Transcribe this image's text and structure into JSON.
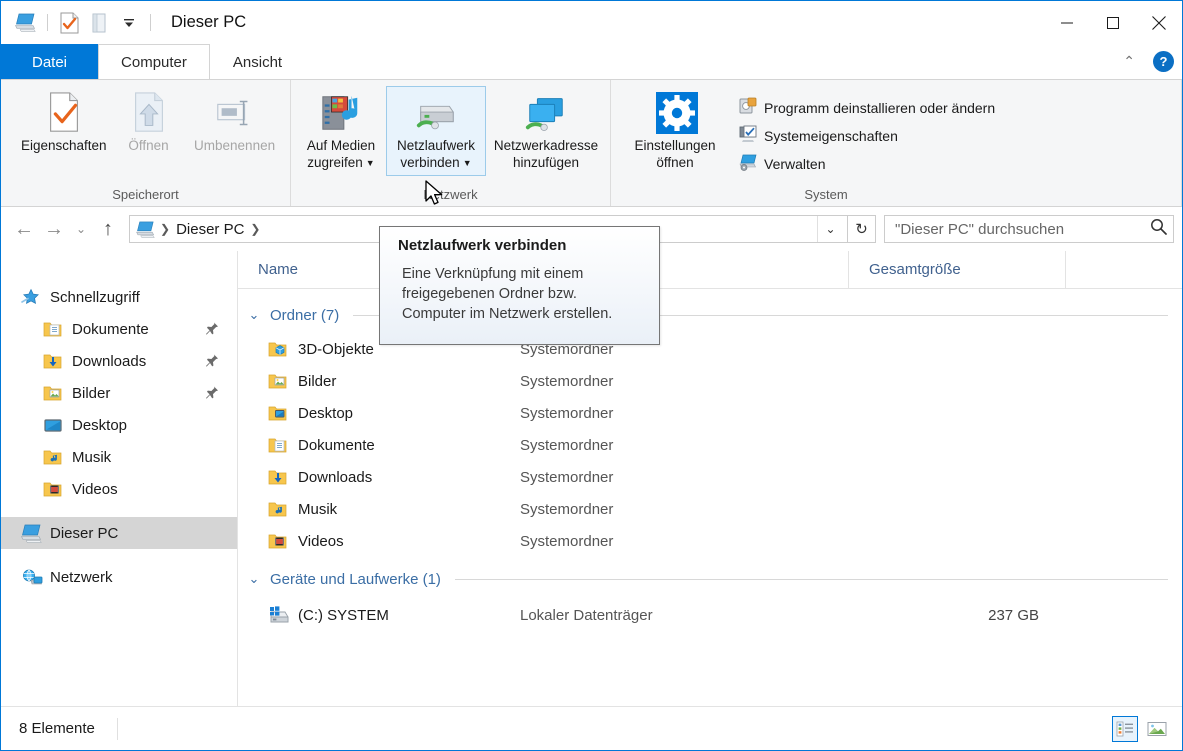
{
  "window": {
    "title": "Dieser PC",
    "quick_access": [
      "pc-icon",
      "properties-check-icon",
      "folder-icon",
      "dropdown-arrow-icon"
    ],
    "controls": {
      "minimize": "—",
      "maximize": "□",
      "close": "✕"
    }
  },
  "tabs": [
    {
      "id": "file",
      "label": "Datei"
    },
    {
      "id": "computer",
      "label": "Computer"
    },
    {
      "id": "view",
      "label": "Ansicht"
    }
  ],
  "ribbon": {
    "collapse_label": "⌃",
    "help_label": "?",
    "groups": [
      {
        "title": "Speicherort",
        "buttons": [
          {
            "label_line1": "Eigenschaften",
            "label_line2": "",
            "icon": "properties-icon",
            "disabled": false,
            "caret": false
          },
          {
            "label_line1": "Öffnen",
            "label_line2": "",
            "icon": "open-icon",
            "disabled": true,
            "caret": false
          },
          {
            "label_line1": "Umbenennen",
            "label_line2": "",
            "icon": "rename-icon",
            "disabled": true,
            "caret": false
          }
        ]
      },
      {
        "title": "Netzwerk",
        "buttons": [
          {
            "label_line1": "Auf Medien",
            "label_line2": "zugreifen",
            "icon": "media-server-icon",
            "disabled": false,
            "caret": true
          },
          {
            "label_line1": "Netzlaufwerk",
            "label_line2": "verbinden",
            "icon": "map-network-drive-icon",
            "disabled": false,
            "caret": true,
            "hover": true
          },
          {
            "label_line1": "Netzwerkadresse",
            "label_line2": "hinzufügen",
            "icon": "add-network-location-icon",
            "disabled": false,
            "caret": false
          }
        ]
      },
      {
        "title": "System",
        "big_button": {
          "label_line1": "Einstellungen",
          "label_line2": "öffnen",
          "icon": "settings-gear-icon"
        },
        "items": [
          {
            "label": "Programm deinstallieren oder ändern",
            "icon": "uninstall-program-icon"
          },
          {
            "label": "Systemeigenschaften",
            "icon": "system-properties-icon"
          },
          {
            "label": "Verwalten",
            "icon": "manage-computer-icon"
          }
        ]
      }
    ]
  },
  "addressbar": {
    "back": "←",
    "forward": "→",
    "recent": "⌄",
    "up": "↑",
    "crumb_icon": "pc-icon",
    "crumb": "Dieser PC",
    "crumb_sep": "❯",
    "dropdown": "⌄",
    "refresh": "↻",
    "search_placeholder": "\"Dieser PC\" durchsuchen",
    "search_value": "",
    "search_icon": "search-icon"
  },
  "sidebar": {
    "items": [
      {
        "label": "Schnellzugriff",
        "icon": "quick-access-star-icon",
        "indent": false,
        "pinned": false,
        "selected": false
      },
      {
        "label": "Dokumente",
        "icon": "documents-folder-icon",
        "indent": true,
        "pinned": true,
        "selected": false
      },
      {
        "label": "Downloads",
        "icon": "downloads-folder-icon",
        "indent": true,
        "pinned": true,
        "selected": false
      },
      {
        "label": "Bilder",
        "icon": "pictures-folder-icon",
        "indent": true,
        "pinned": true,
        "selected": false
      },
      {
        "label": "Desktop",
        "icon": "desktop-icon",
        "indent": true,
        "pinned": false,
        "selected": false
      },
      {
        "label": "Musik",
        "icon": "music-folder-icon",
        "indent": true,
        "pinned": false,
        "selected": false
      },
      {
        "label": "Videos",
        "icon": "videos-folder-icon",
        "indent": true,
        "pinned": false,
        "selected": false
      },
      {
        "label": "Dieser PC",
        "icon": "pc-icon",
        "indent": false,
        "pinned": false,
        "selected": true,
        "gap_before": true
      },
      {
        "label": "Netzwerk",
        "icon": "network-icon",
        "indent": false,
        "pinned": false,
        "selected": false,
        "gap_before": true
      }
    ]
  },
  "columns": [
    {
      "label": "Name"
    },
    {
      "label": ""
    },
    {
      "label": "Gesamtgröße"
    },
    {
      "label": ""
    }
  ],
  "filelist": {
    "groups": [
      {
        "header": "Ordner (7)",
        "chevron": "⌄",
        "rows": [
          {
            "name": "3D-Objekte",
            "icon": "3d-objects-folder-icon",
            "type": "Systemordner",
            "size": ""
          },
          {
            "name": "Bilder",
            "icon": "pictures-folder-icon",
            "type": "Systemordner",
            "size": ""
          },
          {
            "name": "Desktop",
            "icon": "desktop-folder-icon",
            "type": "Systemordner",
            "size": ""
          },
          {
            "name": "Dokumente",
            "icon": "documents-folder-icon",
            "type": "Systemordner",
            "size": ""
          },
          {
            "name": "Downloads",
            "icon": "downloads-folder-icon",
            "type": "Systemordner",
            "size": ""
          },
          {
            "name": "Musik",
            "icon": "music-folder-icon",
            "type": "Systemordner",
            "size": ""
          },
          {
            "name": "Videos",
            "icon": "videos-folder-icon",
            "type": "Systemordner",
            "size": ""
          }
        ]
      },
      {
        "header": "Geräte und Laufwerke (1)",
        "chevron": "⌄",
        "rows": [
          {
            "name": "(C:) SYSTEM",
            "icon": "system-drive-icon",
            "type": "Lokaler Datenträger",
            "size": "237 GB"
          }
        ]
      }
    ]
  },
  "tooltip": {
    "title": "Netzlaufwerk verbinden",
    "line1": "Eine Verknüpfung mit einem",
    "line2": "freigegebenen Ordner bzw.",
    "line3": "Computer im Netzwerk erstellen."
  },
  "statusbar": {
    "items_text": "8 Elemente",
    "views": [
      {
        "name": "details-view-button",
        "selected": true
      },
      {
        "name": "large-icons-view-button",
        "selected": false
      }
    ]
  },
  "colors": {
    "accent": "#0078d7",
    "tab_file": "#0078d7",
    "group_header": "#3b6ea5",
    "selection": "#d5d5d5",
    "hover": "#e8f3fc"
  }
}
